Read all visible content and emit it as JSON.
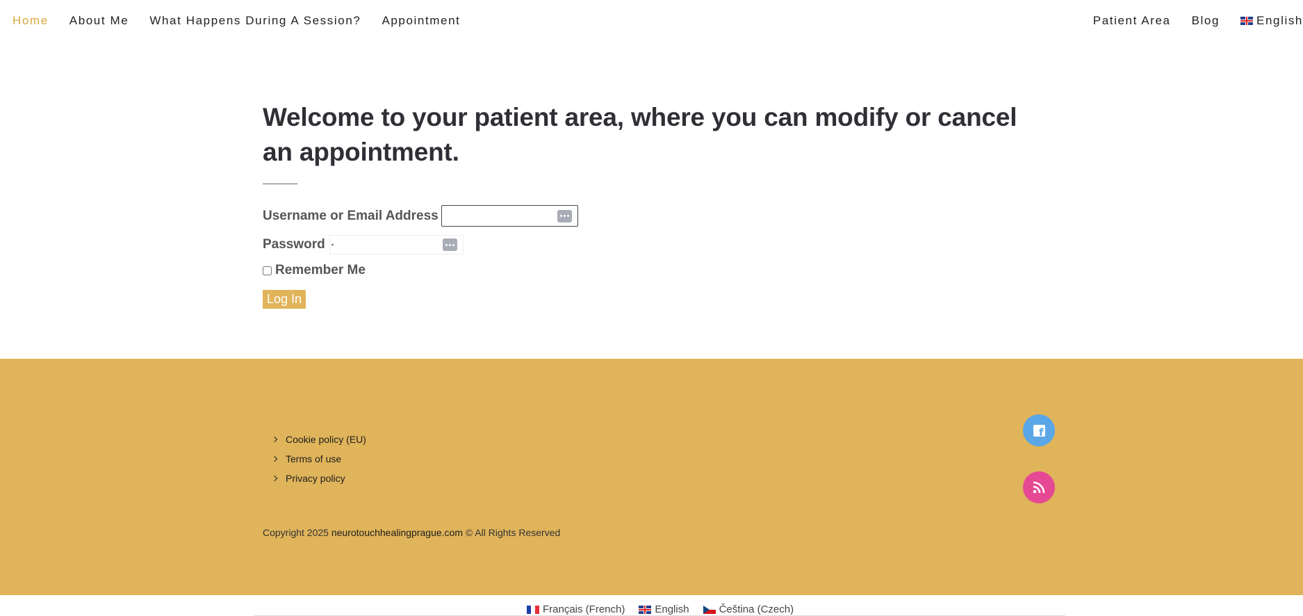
{
  "nav": {
    "left": [
      {
        "label": "Home"
      },
      {
        "label": "About Me"
      },
      {
        "label": "What Happens During A Session?"
      },
      {
        "label": "Appointment"
      }
    ],
    "right": [
      {
        "label": "Patient Area"
      },
      {
        "label": "Blog"
      }
    ],
    "language": "English"
  },
  "main": {
    "title": "Welcome to your patient area, where you can modify or cancel an appointment.",
    "form": {
      "username_label": "Username or Email Address",
      "username_value": "",
      "password_label": "Password",
      "password_value": "",
      "remember_label": "Remember Me",
      "remember_checked": false,
      "submit_label": "Log In"
    }
  },
  "footer": {
    "links": [
      {
        "label": "Cookie policy (EU)"
      },
      {
        "label": "Terms of use"
      },
      {
        "label": "Privacy policy"
      }
    ],
    "copyright_prefix": "Copyright 2025",
    "copyright_site": "neurotouchhealingprague.com",
    "copyright_suffix": "© All Rights Reserved",
    "social": [
      {
        "icon": "facebook-icon",
        "color": "#5aa6e6"
      },
      {
        "icon": "rss-icon",
        "color": "#e64993"
      }
    ],
    "background": "#e0b45a"
  },
  "language_bar": [
    {
      "label": "Français (French)",
      "flag": "fr"
    },
    {
      "label": "English",
      "flag": "uk"
    },
    {
      "label": "Čeština (Czech)",
      "flag": "cz"
    }
  ],
  "colors": {
    "accent": "#d9a83d",
    "button": "#e0b45a"
  }
}
